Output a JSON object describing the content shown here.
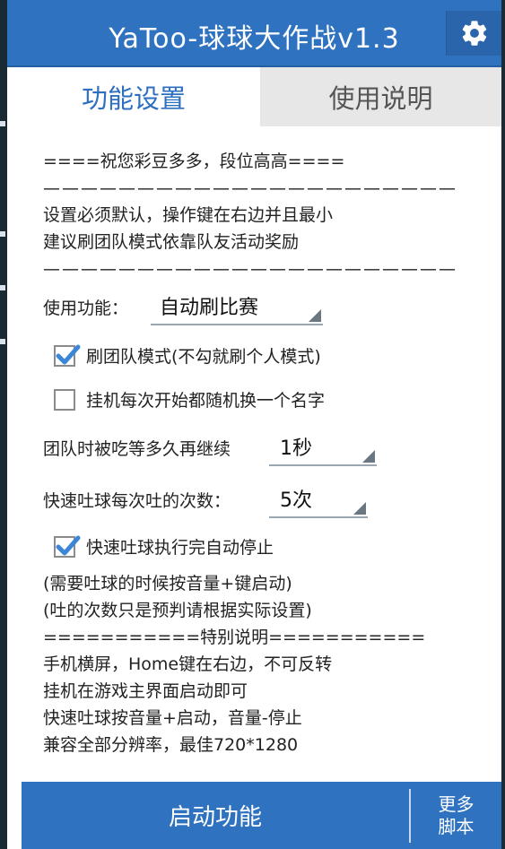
{
  "window": {
    "title": "YaToo-球球大作战v1.3",
    "settings_icon": "gear-icon"
  },
  "tabs": [
    {
      "label": "功能设置",
      "active": true
    },
    {
      "label": "使用说明",
      "active": false
    }
  ],
  "intro": {
    "greeting": "====祝您彩豆多多，段位高高====",
    "separator": "——————————————————————",
    "line1": "设置必须默认，操作键在右边并且最小",
    "line2": "建议刷团队模式依靠队友活动奖励"
  },
  "function_select": {
    "label": "使用功能：",
    "value": "自动刷比赛"
  },
  "checkboxes": {
    "team_mode": {
      "label": "刷团队模式(不勾就刷个人模式)",
      "checked": true
    },
    "random_name": {
      "label": "挂机每次开始都随机换一个名字",
      "checked": false
    },
    "auto_stop": {
      "label": "快速吐球执行完自动停止",
      "checked": true
    }
  },
  "wait_select": {
    "label": "团队时被吃等多久再继续",
    "value": "1秒"
  },
  "spit_select": {
    "label": "快速吐球每次吐的次数：",
    "value": "5次"
  },
  "notes": {
    "n1": "(需要吐球的时候按音量+键启动)",
    "n2": "(吐的次数只是预判请根据实际设置)",
    "n3": "===========特别说明===========",
    "n4": "手机横屏，Home键在右边，不可反转",
    "n5": "挂机在游戏主界面启动即可",
    "n6": "快速吐球按音量+启动，音量-停止",
    "n7": "兼容全部分辨率，最佳720*1280"
  },
  "bottom": {
    "start_label": "启动功能",
    "more_line1": "更多",
    "more_line2": "脚本"
  },
  "colors": {
    "primary": "#2f72c0",
    "check": "#3b86d6",
    "active_tab_text": "#2e6fbf"
  }
}
